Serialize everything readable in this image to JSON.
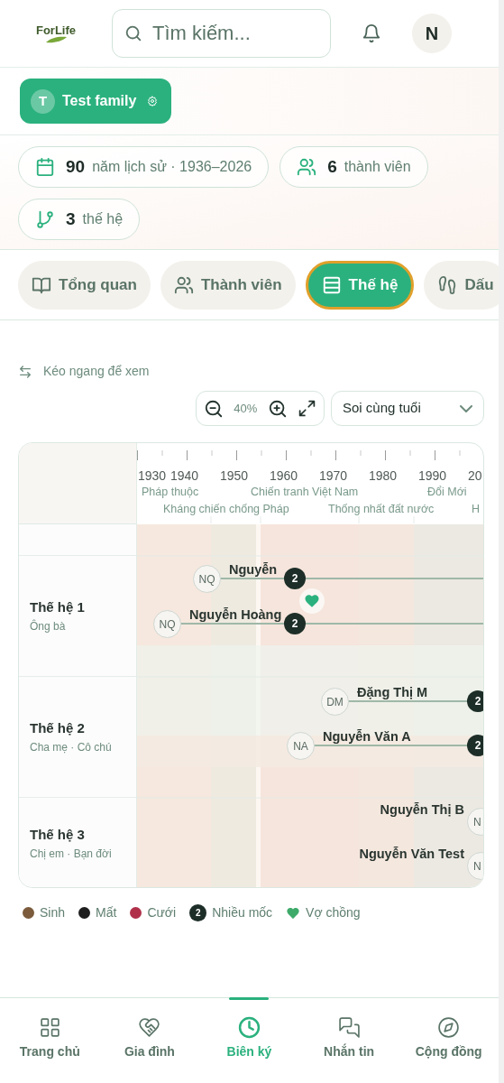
{
  "header": {
    "logo": "ForLife",
    "search": {
      "placeholder": "Tìm kiếm..."
    },
    "avatar": "N"
  },
  "family": {
    "initial": "T",
    "name": "Test family"
  },
  "stats": [
    {
      "value": "90",
      "label": "năm lịch sử · 1936–2026"
    },
    {
      "value": "6",
      "label": "thành viên"
    },
    {
      "value": "3",
      "label": "thế hệ"
    }
  ],
  "tabs": [
    {
      "label": "Tổng quan",
      "selected": false
    },
    {
      "label": "Thành viên",
      "selected": false
    },
    {
      "label": "Thế hệ",
      "selected": true
    },
    {
      "label": "Dấu",
      "selected": false
    }
  ],
  "hint": "Kéo ngang để xem",
  "zoom": {
    "value": "40%"
  },
  "mode_select": {
    "value": "Soi cùng tuổi"
  },
  "timeline": {
    "years": [
      "1930",
      "1940",
      "1950",
      "1960",
      "1970",
      "1980",
      "1990",
      "20"
    ],
    "eras": [
      "Pháp thuộc",
      "Kháng chiến chống Pháp",
      "Chiến tranh Việt Nam",
      "Thống nhất đất nước",
      "Đổi Mới",
      "H"
    ],
    "generations": [
      {
        "title": "Thế hệ 1",
        "subtitle": "Ông bà",
        "couple": true,
        "people": [
          {
            "initials": "NQ",
            "name": "Nguyễn",
            "badge": "2"
          },
          {
            "initials": "NQ",
            "name": "Nguyễn Hoàng",
            "badge": "2"
          }
        ]
      },
      {
        "title": "Thế hệ 2",
        "subtitle": "Cha mẹ · Cô chú",
        "couple": false,
        "people": [
          {
            "initials": "DM",
            "name": "Đặng Thị M",
            "badge": "2"
          },
          {
            "initials": "NA",
            "name": "Nguyễn Văn A",
            "badge": "2"
          }
        ]
      },
      {
        "title": "Thế hệ 3",
        "subtitle": "Chị em · Bạn đời",
        "couple": false,
        "people": [
          {
            "initials": "N",
            "name": "Nguyễn Thị B"
          },
          {
            "initials": "N",
            "name": "Nguyễn Văn Test"
          }
        ]
      }
    ]
  },
  "legend": [
    {
      "kind": "dot",
      "label": "Sinh",
      "color": "#7b5b3c"
    },
    {
      "kind": "dot",
      "label": "Mất",
      "color": "#1e1e1e"
    },
    {
      "kind": "dot",
      "label": "Cưới",
      "color": "#b0304a"
    },
    {
      "kind": "badge",
      "label": "Nhiều mốc",
      "badge": "2"
    },
    {
      "kind": "heart",
      "label": "Vợ chồng"
    }
  ],
  "nav": [
    {
      "label": "Trang chủ",
      "selected": false
    },
    {
      "label": "Gia đình",
      "selected": false
    },
    {
      "label": "Biên ký",
      "selected": true
    },
    {
      "label": "Nhắn tin",
      "selected": false
    },
    {
      "label": "Cộng đồng",
      "selected": false
    }
  ]
}
